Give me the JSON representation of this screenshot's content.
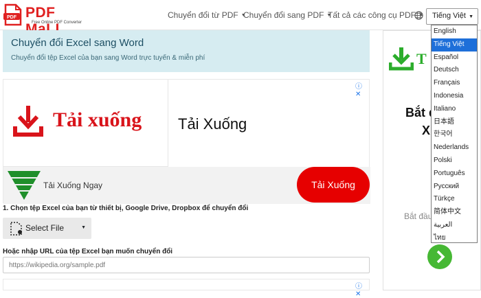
{
  "header": {
    "logo_text": "PDF MaLL",
    "logo_tagline": "Free Online PDF Converter",
    "nav": [
      {
        "label": "Chuyển đổi từ PDF"
      },
      {
        "label": "Chuyển đổi sang PDF"
      },
      {
        "label": "Tất cả các công cụ PDF"
      }
    ],
    "language_selected": "Tiếng Việt",
    "languages": [
      "English",
      "Tiếng Việt",
      "Español",
      "Deutsch",
      "Français",
      "Indonesia",
      "Italiano",
      "日本語",
      "한국어",
      "Nederlands",
      "Polski",
      "Português",
      "Русский",
      "Türkçe",
      "简体中文",
      "العربية",
      "ไทย"
    ]
  },
  "hero": {
    "title": "Chuyển đổi Excel sang Word",
    "subtitle": "Chuyển đổi tệp Excel của bạn sang Word trực tuyến & miễn phí"
  },
  "ad1": {
    "adchoices": "ⓘ ✕",
    "big_text": "Tải xuống",
    "right_text": "Tải Xuống",
    "row_text": "Tải Xuống Ngay",
    "button_label": "Tải Xuống"
  },
  "upload": {
    "step_label": "1. Chọn tệp Excel của bạn từ thiết bị, Google Drive, Dropbox để chuyển đổi",
    "select_file_label": "Select File",
    "url_label": "Hoặc nhập URL của tệp Excel bạn muốn chuyển đổi",
    "url_placeholder": "https://wikipedia.org/sample.pdf"
  },
  "ad2": {
    "adchoices": "ⓘ ✕"
  },
  "sidebar": {
    "logo_text": "T",
    "heading_line1": "Bắt đ",
    "heading_line2": "Xu",
    "muted_text": "Bắt đầu"
  },
  "colors": {
    "brand_red": "#e02020",
    "accent_blue": "#1e6fd9",
    "hero_bg": "#d6ecf1",
    "ad_red": "#e60000",
    "green": "#46b834"
  }
}
